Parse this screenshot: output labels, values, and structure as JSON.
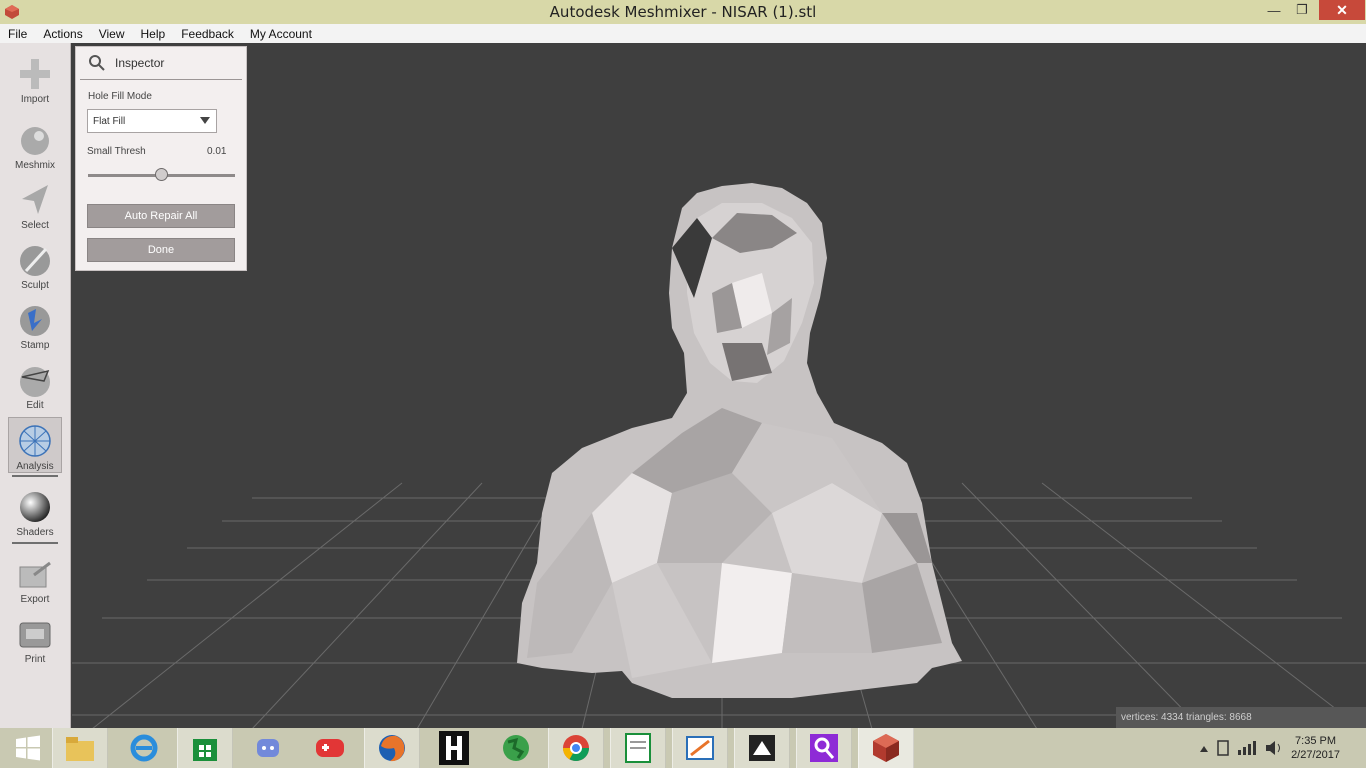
{
  "window": {
    "title": "Autodesk Meshmixer - NISAR (1).stl",
    "minimize_glyph": "—",
    "maximize_glyph": "❐",
    "close_glyph": "✕"
  },
  "menu": {
    "items": [
      "File",
      "Actions",
      "View",
      "Help",
      "Feedback",
      "My Account"
    ]
  },
  "toolbar": {
    "tools": [
      {
        "label": "Import",
        "icon": "plus-icon"
      },
      {
        "label": "Meshmix",
        "icon": "bunny-icon"
      },
      {
        "label": "Select",
        "icon": "arrow-select-icon"
      },
      {
        "label": "Sculpt",
        "icon": "brush-icon"
      },
      {
        "label": "Stamp",
        "icon": "stamp-icon"
      },
      {
        "label": "Edit",
        "icon": "edit-sphere-icon"
      },
      {
        "label": "Analysis",
        "icon": "analysis-sphere-icon"
      },
      {
        "label": "Shaders",
        "icon": "shader-ball-icon"
      },
      {
        "label": "Export",
        "icon": "export-icon"
      },
      {
        "label": "Print",
        "icon": "printer-icon"
      }
    ],
    "active": "Analysis"
  },
  "inspector": {
    "title": "Inspector",
    "hole_fill_label": "Hole Fill Mode",
    "hole_fill_value": "Flat Fill",
    "small_thresh_label": "Small Thresh",
    "small_thresh_value": "0.01",
    "slider_fraction": 0.5,
    "auto_repair_label": "Auto Repair All",
    "done_label": "Done"
  },
  "status": {
    "text": "vertices: 4334 triangles: 8668"
  },
  "taskbar": {
    "clock_time": "7:35 PM",
    "clock_date": "2/27/2017"
  },
  "colors": {
    "viewport_bg": "#3f3f3f",
    "grid": "#6a6a6a",
    "mesh_light": "#e8e4e4",
    "mesh_dark": "#5b5b5b"
  }
}
